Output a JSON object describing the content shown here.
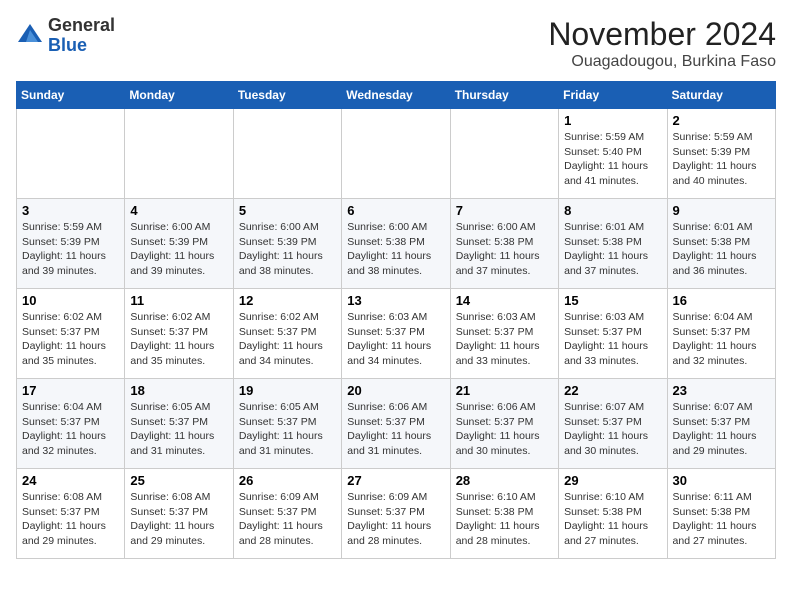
{
  "header": {
    "logo": {
      "line1": "General",
      "line2": "Blue"
    },
    "title": "November 2024",
    "location": "Ouagadougou, Burkina Faso"
  },
  "days_of_week": [
    "Sunday",
    "Monday",
    "Tuesday",
    "Wednesday",
    "Thursday",
    "Friday",
    "Saturday"
  ],
  "weeks": [
    [
      {
        "day": "",
        "info": ""
      },
      {
        "day": "",
        "info": ""
      },
      {
        "day": "",
        "info": ""
      },
      {
        "day": "",
        "info": ""
      },
      {
        "day": "",
        "info": ""
      },
      {
        "day": "1",
        "info": "Sunrise: 5:59 AM\nSunset: 5:40 PM\nDaylight: 11 hours and 41 minutes."
      },
      {
        "day": "2",
        "info": "Sunrise: 5:59 AM\nSunset: 5:39 PM\nDaylight: 11 hours and 40 minutes."
      }
    ],
    [
      {
        "day": "3",
        "info": "Sunrise: 5:59 AM\nSunset: 5:39 PM\nDaylight: 11 hours and 39 minutes."
      },
      {
        "day": "4",
        "info": "Sunrise: 6:00 AM\nSunset: 5:39 PM\nDaylight: 11 hours and 39 minutes."
      },
      {
        "day": "5",
        "info": "Sunrise: 6:00 AM\nSunset: 5:39 PM\nDaylight: 11 hours and 38 minutes."
      },
      {
        "day": "6",
        "info": "Sunrise: 6:00 AM\nSunset: 5:38 PM\nDaylight: 11 hours and 38 minutes."
      },
      {
        "day": "7",
        "info": "Sunrise: 6:00 AM\nSunset: 5:38 PM\nDaylight: 11 hours and 37 minutes."
      },
      {
        "day": "8",
        "info": "Sunrise: 6:01 AM\nSunset: 5:38 PM\nDaylight: 11 hours and 37 minutes."
      },
      {
        "day": "9",
        "info": "Sunrise: 6:01 AM\nSunset: 5:38 PM\nDaylight: 11 hours and 36 minutes."
      }
    ],
    [
      {
        "day": "10",
        "info": "Sunrise: 6:02 AM\nSunset: 5:37 PM\nDaylight: 11 hours and 35 minutes."
      },
      {
        "day": "11",
        "info": "Sunrise: 6:02 AM\nSunset: 5:37 PM\nDaylight: 11 hours and 35 minutes."
      },
      {
        "day": "12",
        "info": "Sunrise: 6:02 AM\nSunset: 5:37 PM\nDaylight: 11 hours and 34 minutes."
      },
      {
        "day": "13",
        "info": "Sunrise: 6:03 AM\nSunset: 5:37 PM\nDaylight: 11 hours and 34 minutes."
      },
      {
        "day": "14",
        "info": "Sunrise: 6:03 AM\nSunset: 5:37 PM\nDaylight: 11 hours and 33 minutes."
      },
      {
        "day": "15",
        "info": "Sunrise: 6:03 AM\nSunset: 5:37 PM\nDaylight: 11 hours and 33 minutes."
      },
      {
        "day": "16",
        "info": "Sunrise: 6:04 AM\nSunset: 5:37 PM\nDaylight: 11 hours and 32 minutes."
      }
    ],
    [
      {
        "day": "17",
        "info": "Sunrise: 6:04 AM\nSunset: 5:37 PM\nDaylight: 11 hours and 32 minutes."
      },
      {
        "day": "18",
        "info": "Sunrise: 6:05 AM\nSunset: 5:37 PM\nDaylight: 11 hours and 31 minutes."
      },
      {
        "day": "19",
        "info": "Sunrise: 6:05 AM\nSunset: 5:37 PM\nDaylight: 11 hours and 31 minutes."
      },
      {
        "day": "20",
        "info": "Sunrise: 6:06 AM\nSunset: 5:37 PM\nDaylight: 11 hours and 31 minutes."
      },
      {
        "day": "21",
        "info": "Sunrise: 6:06 AM\nSunset: 5:37 PM\nDaylight: 11 hours and 30 minutes."
      },
      {
        "day": "22",
        "info": "Sunrise: 6:07 AM\nSunset: 5:37 PM\nDaylight: 11 hours and 30 minutes."
      },
      {
        "day": "23",
        "info": "Sunrise: 6:07 AM\nSunset: 5:37 PM\nDaylight: 11 hours and 29 minutes."
      }
    ],
    [
      {
        "day": "24",
        "info": "Sunrise: 6:08 AM\nSunset: 5:37 PM\nDaylight: 11 hours and 29 minutes."
      },
      {
        "day": "25",
        "info": "Sunrise: 6:08 AM\nSunset: 5:37 PM\nDaylight: 11 hours and 29 minutes."
      },
      {
        "day": "26",
        "info": "Sunrise: 6:09 AM\nSunset: 5:37 PM\nDaylight: 11 hours and 28 minutes."
      },
      {
        "day": "27",
        "info": "Sunrise: 6:09 AM\nSunset: 5:37 PM\nDaylight: 11 hours and 28 minutes."
      },
      {
        "day": "28",
        "info": "Sunrise: 6:10 AM\nSunset: 5:38 PM\nDaylight: 11 hours and 28 minutes."
      },
      {
        "day": "29",
        "info": "Sunrise: 6:10 AM\nSunset: 5:38 PM\nDaylight: 11 hours and 27 minutes."
      },
      {
        "day": "30",
        "info": "Sunrise: 6:11 AM\nSunset: 5:38 PM\nDaylight: 11 hours and 27 minutes."
      }
    ]
  ]
}
